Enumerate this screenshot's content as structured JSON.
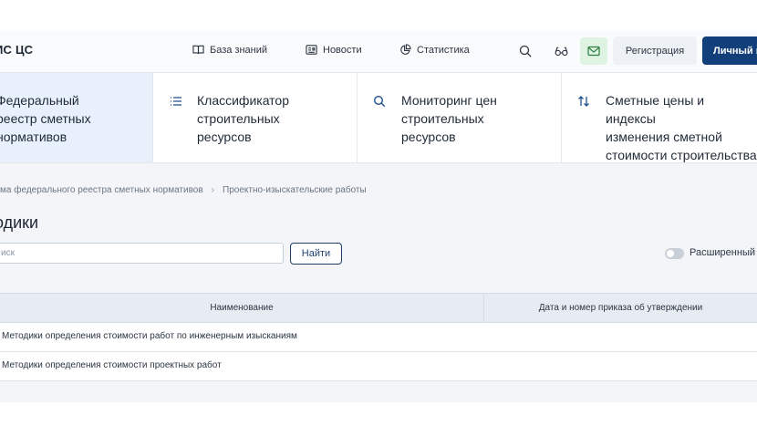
{
  "app": {
    "logo": "ИС ЦС"
  },
  "nav": [
    {
      "label": "База знаний",
      "icon": "book-icon"
    },
    {
      "label": "Новости",
      "icon": "news-icon"
    },
    {
      "label": "Статистика",
      "icon": "pie-chart-icon"
    }
  ],
  "header_buttons": {
    "register": "Регистрация",
    "cabinet": "Личный к"
  },
  "tiles": [
    {
      "label": "Федеральный\nреестр сметных\nнормативов",
      "icon": "registry-icon",
      "active": true
    },
    {
      "label": "Классификатор\nстроительных\nресурсов",
      "icon": "list-icon",
      "active": false
    },
    {
      "label": "Мониторинг цен\nстроительных\nресурсов",
      "icon": "search-icon",
      "active": false
    },
    {
      "label": "Сметные цены и индексы\nизменения сметной\nстоимости строительства",
      "icon": "sort-arrows-icon",
      "active": false
    }
  ],
  "breadcrumb": [
    "тема федерального реестра сметных нормативов",
    "Проектно-изыскательские работы"
  ],
  "page_title": "одики",
  "search": {
    "placeholder": "иск",
    "button": "Найти"
  },
  "advanced_toggle": {
    "label": "Расширенный",
    "on": false
  },
  "table": {
    "columns": [
      "Наименование",
      "Дата и номер приказа об утверждении"
    ],
    "rows": [
      "Методики определения стоимости работ по инженерным изысканиям",
      "Методики определения стоимости проектных работ"
    ]
  },
  "colors": {
    "primary": "#123f7a",
    "active_tile": "#e8f1fb",
    "mail_bg": "#dff3e3",
    "content_bg": "#f3f5f8"
  }
}
